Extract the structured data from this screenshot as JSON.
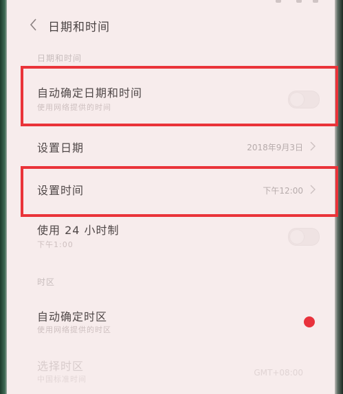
{
  "header": {
    "title": "日期和时间"
  },
  "sections": {
    "datetime_label": "日期和时间",
    "timezone_label": "时区"
  },
  "rows": {
    "auto_datetime": {
      "title": "自动确定日期和时间",
      "subtitle": "使用网络提供的时间",
      "enabled": false
    },
    "set_date": {
      "title": "设置日期",
      "value": "2018年9月3日"
    },
    "set_time": {
      "title": "设置时间",
      "value": "下午12:00"
    },
    "use_24h": {
      "title": "使用 24 小时制",
      "subtitle": "下午1:00",
      "enabled": false
    },
    "auto_timezone": {
      "title": "自动确定时区",
      "subtitle": "使用网络提供的时区",
      "enabled": true
    },
    "select_timezone": {
      "title": "选择时区",
      "subtitle": "中国标准时间",
      "value": "GMT+08:00"
    }
  },
  "colors": {
    "accent": "#e8323c",
    "highlight_border": "#ea3339",
    "background": "#f7ecec"
  }
}
